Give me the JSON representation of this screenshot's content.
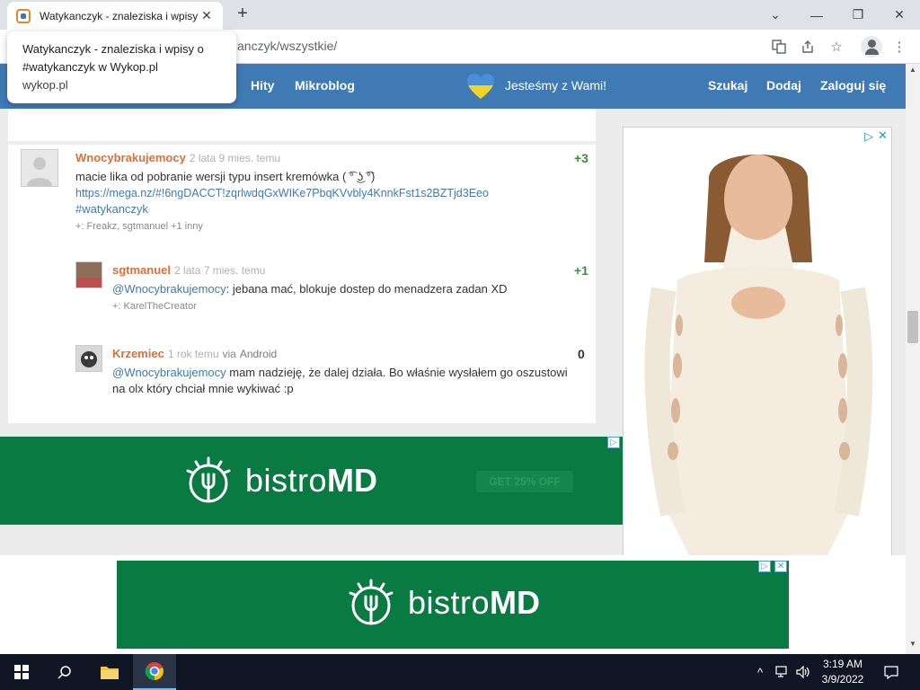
{
  "browser": {
    "tab_title": "Watykanczyk - znaleziska i wpisy",
    "url_fragment": "anczyk/wszystkie/",
    "tooltip": {
      "line1": "Watykanczyk - znaleziska i wpisy o",
      "line2": "#watykanczyk w Wykop.pl",
      "host": "wykop.pl"
    }
  },
  "nav": {
    "hity": "Hity",
    "mikroblog": "Mikroblog",
    "ukraine_text": "Jesteśmy z Wami!",
    "szukaj": "Szukaj",
    "dodaj": "Dodaj",
    "zaloguj": "Zaloguj się"
  },
  "entries": [
    {
      "author": "Wnocybrakujemocy",
      "time": "2 lata 9 mies. temu",
      "score": "+3",
      "text": "macie lika od pobranie wersji typu insert kremówka ( ͡° ͜ʖ ͡°)",
      "link": "https://mega.nz/#!6ngDACCT!zqrlwdqGxWIKe7PbqKVvbly4KnnkFst1s2BZTjd3Eeo",
      "tag": "#watykanczyk",
      "pluses": "+: Freakz, sgtmanuel +1 inny"
    },
    {
      "author": "sgtmanuel",
      "time": "2 lata 7 mies. temu",
      "score": "+1",
      "mention": "@Wnocybrakujemocy",
      "text": ": jebana mać, blokuje dostep do menadzera zadan XD",
      "pluses": "+: KarelTheCreator"
    },
    {
      "author": "Krzemiec",
      "time": "1 rok temu",
      "via_label": "via",
      "via": "Android",
      "score": "0",
      "mention": "@Wnocybrakujemocy",
      "text_line1": " mam nadzieję, że dalej działa. Bo właśnie wysłałem go oszustowi",
      "text_line2": "na olx który chciał mnie wykiwać :p"
    }
  ],
  "ads": {
    "brand_light": "bistro",
    "brand_bold": "MD",
    "cta": "GET 25% OFF"
  },
  "taskbar": {
    "time": "3:19 AM",
    "date": "3/9/2022"
  },
  "colors": {
    "wykop_blue": "#3f7ab5",
    "author_orange": "#e16d37",
    "score_green": "#3b8f3b",
    "bistro_green": "#0a7a43"
  }
}
